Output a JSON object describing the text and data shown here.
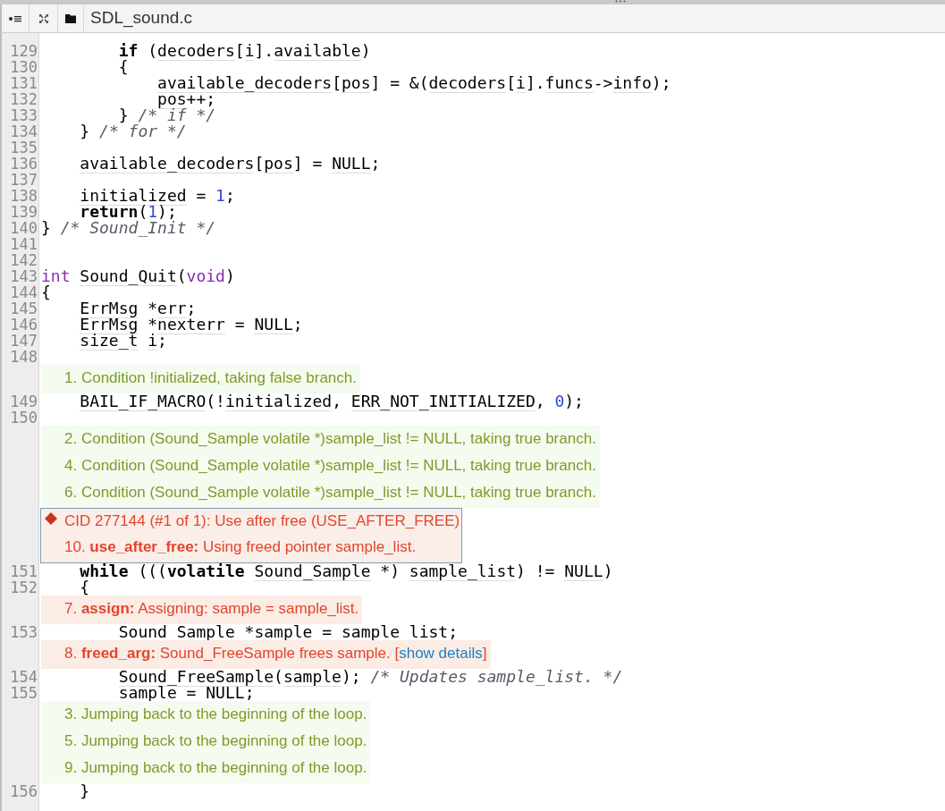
{
  "tab": {
    "title": "SDL_sound.c"
  },
  "rows": [
    {
      "kind": "code",
      "number": "129",
      "tokens": [
        {
          "kind": "kw",
          "text": "        if"
        },
        {
          "kind": "p",
          "text": " ("
        },
        {
          "kind": "id",
          "text": "decoders"
        },
        {
          "kind": "p",
          "text": "["
        },
        {
          "kind": "id",
          "text": "i"
        },
        {
          "kind": "p",
          "text": "]."
        },
        {
          "kind": "id",
          "text": "available"
        },
        {
          "kind": "p",
          "text": ")"
        }
      ]
    },
    {
      "kind": "code",
      "number": "130",
      "tokens": [
        {
          "kind": "p",
          "text": "        {"
        }
      ]
    },
    {
      "kind": "code",
      "number": "131",
      "tokens": [
        {
          "kind": "id",
          "text": "            available_decoders"
        },
        {
          "kind": "p",
          "text": "["
        },
        {
          "kind": "id",
          "text": "pos"
        },
        {
          "kind": "p",
          "text": "] = &("
        },
        {
          "kind": "id",
          "text": "decoders"
        },
        {
          "kind": "p",
          "text": "["
        },
        {
          "kind": "id",
          "text": "i"
        },
        {
          "kind": "p",
          "text": "]."
        },
        {
          "kind": "id",
          "text": "funcs"
        },
        {
          "kind": "p",
          "text": "->"
        },
        {
          "kind": "id",
          "text": "info"
        },
        {
          "kind": "p",
          "text": ");"
        }
      ]
    },
    {
      "kind": "code",
      "number": "132",
      "tokens": [
        {
          "kind": "id",
          "text": "            pos"
        },
        {
          "kind": "p",
          "text": "++;"
        }
      ]
    },
    {
      "kind": "code",
      "number": "133",
      "tokens": [
        {
          "kind": "p",
          "text": "        } "
        },
        {
          "kind": "c",
          "text": "/* if */"
        }
      ]
    },
    {
      "kind": "code",
      "number": "134",
      "tokens": [
        {
          "kind": "p",
          "text": "    } "
        },
        {
          "kind": "c",
          "text": "/* for */"
        }
      ]
    },
    {
      "kind": "code",
      "number": "135",
      "tokens": []
    },
    {
      "kind": "code",
      "number": "136",
      "tokens": [
        {
          "kind": "id",
          "text": "    available_decoders"
        },
        {
          "kind": "p",
          "text": "["
        },
        {
          "kind": "id",
          "text": "pos"
        },
        {
          "kind": "p",
          "text": "] = "
        },
        {
          "kind": "id",
          "text": "NULL"
        },
        {
          "kind": "p",
          "text": ";"
        }
      ]
    },
    {
      "kind": "code",
      "number": "137",
      "tokens": []
    },
    {
      "kind": "code",
      "number": "138",
      "tokens": [
        {
          "kind": "id",
          "text": "    initialized"
        },
        {
          "kind": "p",
          "text": " = "
        },
        {
          "kind": "n",
          "text": "1"
        },
        {
          "kind": "p",
          "text": ";"
        }
      ]
    },
    {
      "kind": "code",
      "number": "139",
      "tokens": [
        {
          "kind": "kw",
          "text": "    return"
        },
        {
          "kind": "p",
          "text": "("
        },
        {
          "kind": "n",
          "text": "1"
        },
        {
          "kind": "p",
          "text": ");"
        }
      ]
    },
    {
      "kind": "code",
      "number": "140",
      "tokens": [
        {
          "kind": "p",
          "text": "} "
        },
        {
          "kind": "c",
          "text": "/* Sound_Init */"
        }
      ]
    },
    {
      "kind": "code",
      "number": "141",
      "tokens": []
    },
    {
      "kind": "code",
      "number": "142",
      "tokens": []
    },
    {
      "kind": "code",
      "number": "143",
      "tokens": [
        {
          "kind": "ty",
          "text": "int"
        },
        {
          "kind": "id",
          "text": " Sound_Quit"
        },
        {
          "kind": "p",
          "text": "("
        },
        {
          "kind": "ty",
          "text": "void"
        },
        {
          "kind": "p",
          "text": ")"
        }
      ]
    },
    {
      "kind": "code",
      "number": "144",
      "tokens": [
        {
          "kind": "p",
          "text": "{"
        }
      ]
    },
    {
      "kind": "code",
      "number": "145",
      "tokens": [
        {
          "kind": "id",
          "text": "    ErrMsg"
        },
        {
          "kind": "p",
          "text": " *"
        },
        {
          "kind": "id",
          "text": "err"
        },
        {
          "kind": "p",
          "text": ";"
        }
      ]
    },
    {
      "kind": "code",
      "number": "146",
      "tokens": [
        {
          "kind": "id",
          "text": "    ErrMsg"
        },
        {
          "kind": "p",
          "text": " *"
        },
        {
          "kind": "id",
          "text": "nexterr"
        },
        {
          "kind": "p",
          "text": " = "
        },
        {
          "kind": "id",
          "text": "NULL"
        },
        {
          "kind": "p",
          "text": ";"
        }
      ]
    },
    {
      "kind": "code",
      "number": "147",
      "tokens": [
        {
          "kind": "id",
          "text": "    size_t"
        },
        {
          "kind": "id",
          "text": " i"
        },
        {
          "kind": "p",
          "text": ";"
        }
      ]
    },
    {
      "kind": "code",
      "number": "148",
      "tokens": []
    },
    {
      "kind": "path_events",
      "items": [
        {
          "text": "1. Condition !initialized, taking false branch."
        }
      ]
    },
    {
      "kind": "code",
      "number": "149",
      "tokens": [
        {
          "kind": "id",
          "text": "    BAIL_IF_MACRO"
        },
        {
          "kind": "p",
          "text": "(!"
        },
        {
          "kind": "id",
          "text": "initialized"
        },
        {
          "kind": "p",
          "text": ", "
        },
        {
          "kind": "id",
          "text": "ERR_NOT_INITIALIZED"
        },
        {
          "kind": "p",
          "text": ", "
        },
        {
          "kind": "n",
          "text": "0"
        },
        {
          "kind": "p",
          "text": ");"
        }
      ]
    },
    {
      "kind": "code",
      "number": "150",
      "tokens": []
    },
    {
      "kind": "path_events",
      "items": [
        {
          "text": "2. Condition (Sound_Sample volatile *)sample_list != NULL, taking true branch."
        },
        {
          "text": "4. Condition (Sound_Sample volatile *)sample_list != NULL, taking true branch."
        },
        {
          "text": "6. Condition (Sound_Sample volatile *)sample_list != NULL, taking true branch."
        }
      ]
    },
    {
      "kind": "defect",
      "title": "CID 277144 (#1 of 1): Use after free (USE_AFTER_FREE)",
      "items": [
        {
          "text": "10. **use_after_free:** Using freed pointer sample_list."
        }
      ]
    },
    {
      "kind": "code",
      "number": "151",
      "tokens": [
        {
          "kind": "kw",
          "text": "    while"
        },
        {
          "kind": "p",
          "text": " ((("
        },
        {
          "kind": "kw",
          "text": "volatile"
        },
        {
          "kind": "id",
          "text": " Sound_Sample"
        },
        {
          "kind": "p",
          "text": " *) "
        },
        {
          "kind": "id",
          "text": "sample_list"
        },
        {
          "kind": "p",
          "text": ") != "
        },
        {
          "kind": "id",
          "text": "NULL"
        },
        {
          "kind": "p",
          "text": ")"
        }
      ]
    },
    {
      "kind": "code",
      "number": "152",
      "tokens": [
        {
          "kind": "p",
          "text": "    {"
        }
      ]
    },
    {
      "kind": "defect_events",
      "items": [
        {
          "text": "7. **assign:** Assigning: sample = sample_list."
        }
      ]
    },
    {
      "kind": "code",
      "number": "153",
      "tokens": [
        {
          "kind": "id",
          "text": "        Sound_Sample"
        },
        {
          "kind": "p",
          "text": " *"
        },
        {
          "kind": "id",
          "text": "sample"
        },
        {
          "kind": "p",
          "text": " = "
        },
        {
          "kind": "id",
          "text": "sample_list"
        },
        {
          "kind": "p",
          "text": ";"
        }
      ]
    },
    {
      "kind": "defect_events",
      "items": [
        {
          "text": "8. **freed_arg:** Sound_FreeSample frees sample. [",
          "link": "show details",
          "after": "]"
        }
      ]
    },
    {
      "kind": "code",
      "number": "154",
      "tokens": [
        {
          "kind": "id",
          "text": "        Sound_FreeSample"
        },
        {
          "kind": "p",
          "text": "("
        },
        {
          "kind": "id",
          "text": "sample"
        },
        {
          "kind": "p",
          "text": "); "
        },
        {
          "kind": "c",
          "text": "/* Updates sample_list. */"
        }
      ]
    },
    {
      "kind": "code",
      "number": "155",
      "tokens": [
        {
          "kind": "id",
          "text": "        sample"
        },
        {
          "kind": "p",
          "text": " = "
        },
        {
          "kind": "id",
          "text": "NULL"
        },
        {
          "kind": "p",
          "text": ";"
        }
      ]
    },
    {
      "kind": "path_events",
      "items": [
        {
          "text": "3. Jumping back to the beginning of the loop."
        },
        {
          "text": "5. Jumping back to the beginning of the loop."
        },
        {
          "text": "9. Jumping back to the beginning of the loop."
        }
      ]
    },
    {
      "kind": "code",
      "number": "156",
      "tokens": [
        {
          "kind": "p",
          "text": "    }"
        }
      ]
    }
  ]
}
